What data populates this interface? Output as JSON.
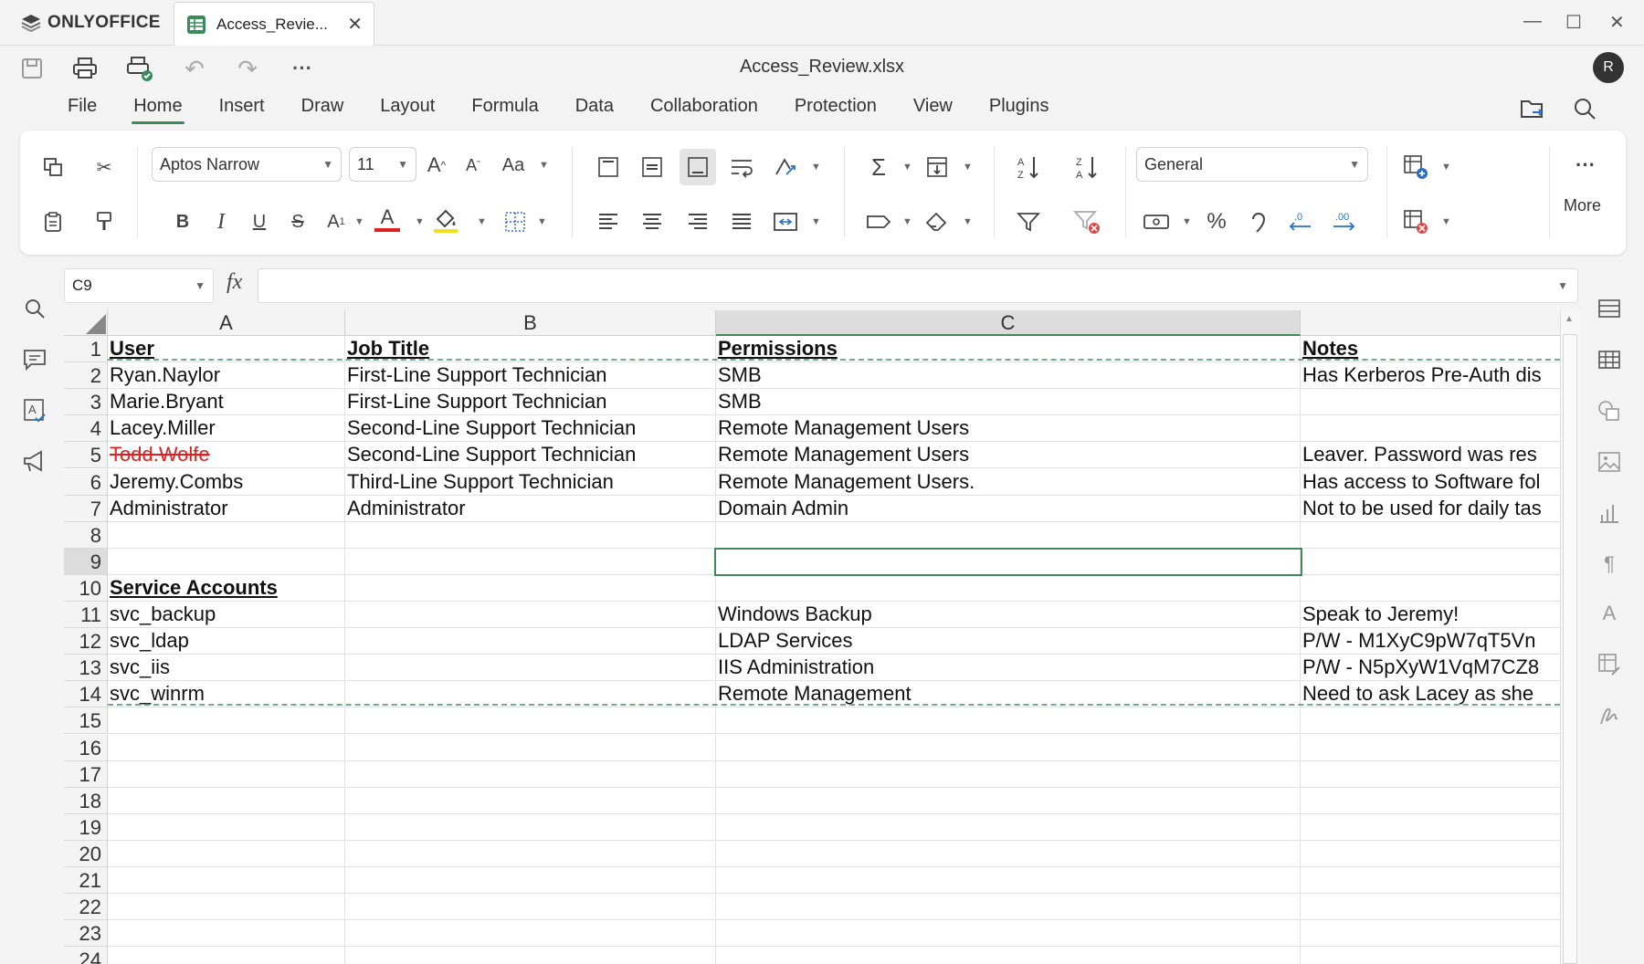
{
  "app": {
    "brand": "ONLYOFFICE",
    "tab_title": "Access_Revie...",
    "doc_title": "Access_Review.xlsx",
    "avatar_initial": "R"
  },
  "menu": [
    "File",
    "Home",
    "Insert",
    "Draw",
    "Layout",
    "Formula",
    "Data",
    "Collaboration",
    "Protection",
    "View",
    "Plugins"
  ],
  "active_menu": "Home",
  "ribbon": {
    "font_name": "Aptos Narrow",
    "font_size": "11",
    "number_format": "General",
    "more_label": "More"
  },
  "formula_bar": {
    "cell_ref": "C9",
    "fx": "fx",
    "formula": ""
  },
  "columns": [
    "A",
    "B",
    "C",
    ""
  ],
  "active_column": "C",
  "rows": [
    {
      "n": "1",
      "a": "User",
      "b": "Job Title",
      "c": "Permissions",
      "d": "Notes"
    },
    {
      "n": "2",
      "a": "Ryan.Naylor",
      "b": "First-Line Support Technician",
      "c": "SMB",
      "d": "Has Kerberos Pre-Auth dis"
    },
    {
      "n": "3",
      "a": "Marie.Bryant",
      "b": "First-Line Support Technician",
      "c": "SMB",
      "d": ""
    },
    {
      "n": "4",
      "a": "Lacey.Miller",
      "b": "Second-Line Support Technician",
      "c": "Remote Management Users",
      "d": ""
    },
    {
      "n": "5",
      "a": "Todd.Wolfe",
      "b": "Second-Line Support Technician",
      "c": "Remote Management Users",
      "d": "Leaver. Password was res"
    },
    {
      "n": "6",
      "a": "Jeremy.Combs",
      "b": "Third-Line Support Technician",
      "c": "Remote Management Users.",
      "d": "Has access to Software fol"
    },
    {
      "n": "7",
      "a": "Administrator",
      "b": "Administrator",
      "c": "Domain Admin",
      "d": "Not to be used for daily tas"
    },
    {
      "n": "8",
      "a": "",
      "b": "",
      "c": "",
      "d": ""
    },
    {
      "n": "9",
      "a": "",
      "b": "",
      "c": "",
      "d": ""
    },
    {
      "n": "10",
      "a": "Service Accounts",
      "b": "",
      "c": "",
      "d": ""
    },
    {
      "n": "11",
      "a": "svc_backup",
      "b": "",
      "c": "Windows Backup",
      "d": "Speak to Jeremy!"
    },
    {
      "n": "12",
      "a": "svc_ldap",
      "b": "",
      "c": "LDAP Services",
      "d": "P/W - M1XyC9pW7qT5Vn"
    },
    {
      "n": "13",
      "a": "svc_iis",
      "b": "",
      "c": "IIS Administration",
      "d": "P/W - N5pXyW1VqM7CZ8"
    },
    {
      "n": "14",
      "a": "svc_winrm",
      "b": "",
      "c": "Remote Management",
      "d": "Need to ask Lacey as she"
    },
    {
      "n": "15",
      "a": "",
      "b": "",
      "c": "",
      "d": ""
    },
    {
      "n": "16",
      "a": "",
      "b": "",
      "c": "",
      "d": ""
    },
    {
      "n": "17",
      "a": "",
      "b": "",
      "c": "",
      "d": ""
    },
    {
      "n": "18",
      "a": "",
      "b": "",
      "c": "",
      "d": ""
    },
    {
      "n": "19",
      "a": "",
      "b": "",
      "c": "",
      "d": ""
    },
    {
      "n": "20",
      "a": "",
      "b": "",
      "c": "",
      "d": ""
    },
    {
      "n": "21",
      "a": "",
      "b": "",
      "c": "",
      "d": ""
    },
    {
      "n": "22",
      "a": "",
      "b": "",
      "c": "",
      "d": ""
    },
    {
      "n": "23",
      "a": "",
      "b": "",
      "c": "",
      "d": ""
    },
    {
      "n": "24",
      "a": "",
      "b": "",
      "c": "",
      "d": ""
    }
  ],
  "header_rows": [
    "1",
    "10"
  ],
  "strike_cells": [
    "5.a"
  ],
  "selected_cell": "C9",
  "colors": {
    "accent": "#3a8a5a",
    "strike": "#e02020"
  }
}
